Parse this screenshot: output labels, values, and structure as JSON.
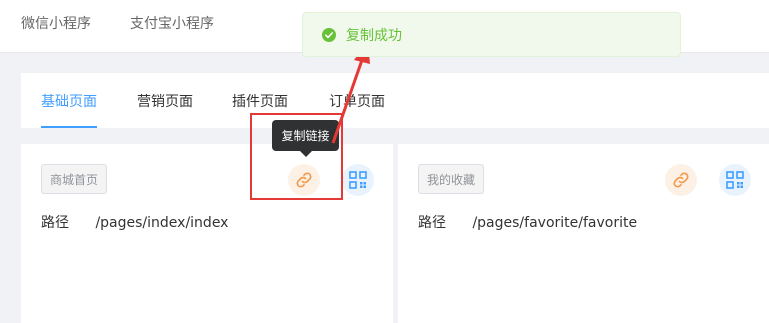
{
  "top_tabs": [
    {
      "label": "微信小程序"
    },
    {
      "label": "支付宝小程序"
    }
  ],
  "page_tabs": [
    {
      "label": "基础页面",
      "active": true
    },
    {
      "label": "营销页面",
      "active": false
    },
    {
      "label": "插件页面",
      "active": false
    },
    {
      "label": "订单页面",
      "active": false
    }
  ],
  "cards": [
    {
      "tag": "商城首页",
      "path_label": "路径",
      "path": "/pages/index/index"
    },
    {
      "tag": "我的收藏",
      "path_label": "路径",
      "path": "/pages/favorite/favorite"
    }
  ],
  "tooltip": {
    "text": "复制链接"
  },
  "toast": {
    "message": "复制成功",
    "type": "success"
  },
  "icons": {
    "link": "link-icon",
    "qr": "qrcode-icon",
    "success": "check-circle-icon"
  },
  "colors": {
    "primary": "#409eff",
    "success": "#67c23a",
    "link_icon": "#f39a4c",
    "annotation": "#e53935"
  }
}
